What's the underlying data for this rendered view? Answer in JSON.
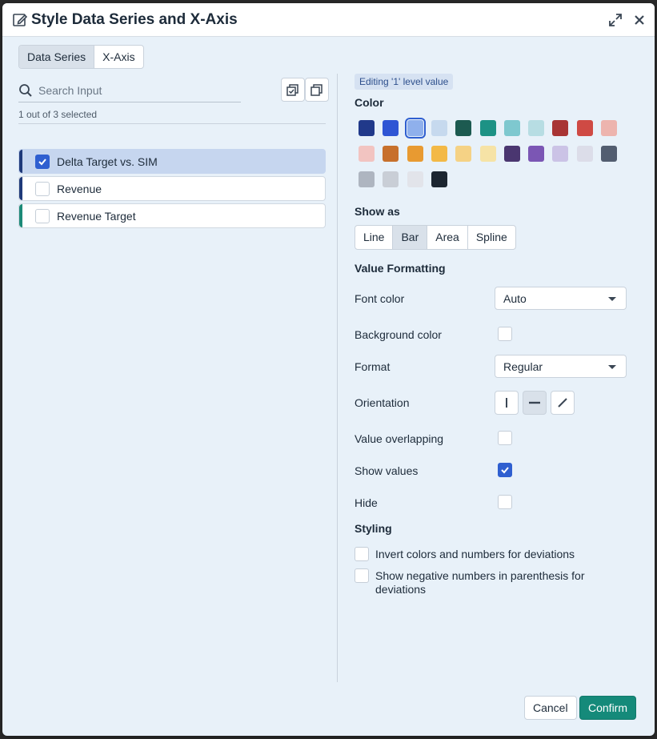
{
  "dialog": {
    "title": "Style Data Series and X-Axis"
  },
  "tabs": [
    {
      "label": "Data Series",
      "active": true
    },
    {
      "label": "X-Axis",
      "active": false
    }
  ],
  "search": {
    "placeholder": "Search Input",
    "value": ""
  },
  "selection": {
    "count_text": "1 out of 3 selected"
  },
  "series": [
    {
      "label": "Delta Target vs. SIM",
      "checked": true,
      "stripe": "#1f3a7a"
    },
    {
      "label": "Revenue",
      "checked": false,
      "stripe": "#1f3a7a"
    },
    {
      "label": "Revenue Target",
      "checked": false,
      "stripe": "#1d8a78"
    }
  ],
  "editing": {
    "badge": "Editing '1' level value"
  },
  "color": {
    "title": "Color",
    "swatches": [
      "#21398a",
      "#2f55d4",
      "#8fb0ec",
      "#c6d9ee",
      "#1c5a50",
      "#1d9285",
      "#7ec8cf",
      "#b7dde3",
      "#a83434",
      "#cf4a44",
      "#edb4ae",
      "#f2c4c1",
      "#c7702c",
      "#e89a31",
      "#f3b946",
      "#f5d285",
      "#f6e3a6",
      "#4a3670",
      "#7b56b4",
      "#cbc3e6",
      "#dcdde9",
      "#525d70",
      "#aeb5c0",
      "#c9ced6",
      "#e2e4ea",
      "#1c2630"
    ],
    "selected_index": 2
  },
  "show_as": {
    "title": "Show as",
    "options": [
      {
        "label": "Line",
        "active": false
      },
      {
        "label": "Bar",
        "active": true
      },
      {
        "label": "Area",
        "active": false
      },
      {
        "label": "Spline",
        "active": false
      }
    ]
  },
  "value_formatting": {
    "title": "Value Formatting",
    "font_color_label": "Font color",
    "font_color_value": "Auto",
    "background_color_label": "Background color",
    "background_color_checked": false,
    "format_label": "Format",
    "format_value": "Regular",
    "orientation_label": "Orientation",
    "orientation_selected": "horizontal",
    "value_overlapping_label": "Value overlapping",
    "value_overlapping_checked": false,
    "show_values_label": "Show values",
    "show_values_checked": true,
    "hide_label": "Hide",
    "hide_checked": false
  },
  "styling": {
    "title": "Styling",
    "invert_label": "Invert colors and numbers for deviations",
    "invert_checked": false,
    "negative_label": "Show negative numbers in parenthesis for deviations",
    "negative_checked": false
  },
  "footer": {
    "cancel_label": "Cancel",
    "confirm_label": "Confirm"
  },
  "theme": {
    "accent": "#2f5fd0",
    "confirm": "#158a7a"
  }
}
